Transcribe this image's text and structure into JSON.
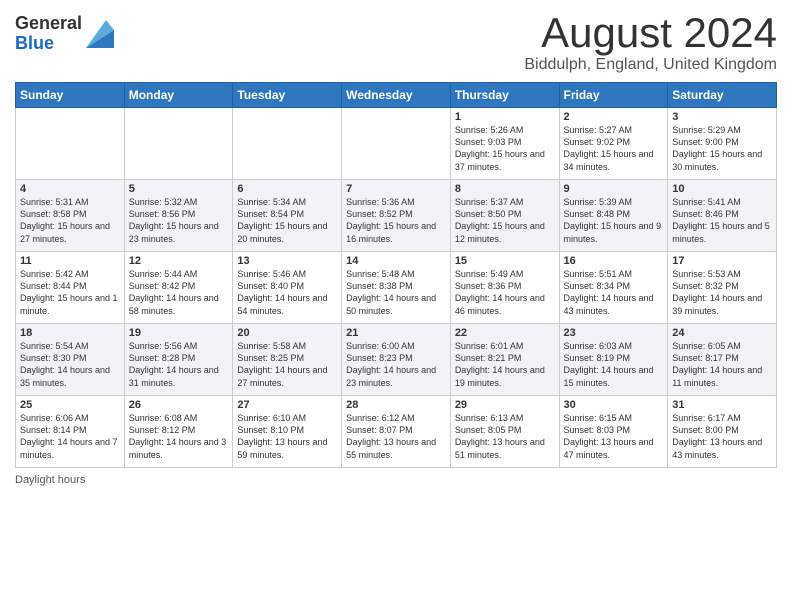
{
  "logo": {
    "general": "General",
    "blue": "Blue"
  },
  "title": "August 2024",
  "location": "Biddulph, England, United Kingdom",
  "footer": "Daylight hours",
  "days_of_week": [
    "Sunday",
    "Monday",
    "Tuesday",
    "Wednesday",
    "Thursday",
    "Friday",
    "Saturday"
  ],
  "weeks": [
    [
      {
        "day": "",
        "sunrise": "",
        "sunset": "",
        "daylight": ""
      },
      {
        "day": "",
        "sunrise": "",
        "sunset": "",
        "daylight": ""
      },
      {
        "day": "",
        "sunrise": "",
        "sunset": "",
        "daylight": ""
      },
      {
        "day": "",
        "sunrise": "",
        "sunset": "",
        "daylight": ""
      },
      {
        "day": "1",
        "sunrise": "Sunrise: 5:26 AM",
        "sunset": "Sunset: 9:03 PM",
        "daylight": "Daylight: 15 hours and 37 minutes."
      },
      {
        "day": "2",
        "sunrise": "Sunrise: 5:27 AM",
        "sunset": "Sunset: 9:02 PM",
        "daylight": "Daylight: 15 hours and 34 minutes."
      },
      {
        "day": "3",
        "sunrise": "Sunrise: 5:29 AM",
        "sunset": "Sunset: 9:00 PM",
        "daylight": "Daylight: 15 hours and 30 minutes."
      }
    ],
    [
      {
        "day": "4",
        "sunrise": "Sunrise: 5:31 AM",
        "sunset": "Sunset: 8:58 PM",
        "daylight": "Daylight: 15 hours and 27 minutes."
      },
      {
        "day": "5",
        "sunrise": "Sunrise: 5:32 AM",
        "sunset": "Sunset: 8:56 PM",
        "daylight": "Daylight: 15 hours and 23 minutes."
      },
      {
        "day": "6",
        "sunrise": "Sunrise: 5:34 AM",
        "sunset": "Sunset: 8:54 PM",
        "daylight": "Daylight: 15 hours and 20 minutes."
      },
      {
        "day": "7",
        "sunrise": "Sunrise: 5:36 AM",
        "sunset": "Sunset: 8:52 PM",
        "daylight": "Daylight: 15 hours and 16 minutes."
      },
      {
        "day": "8",
        "sunrise": "Sunrise: 5:37 AM",
        "sunset": "Sunset: 8:50 PM",
        "daylight": "Daylight: 15 hours and 12 minutes."
      },
      {
        "day": "9",
        "sunrise": "Sunrise: 5:39 AM",
        "sunset": "Sunset: 8:48 PM",
        "daylight": "Daylight: 15 hours and 9 minutes."
      },
      {
        "day": "10",
        "sunrise": "Sunrise: 5:41 AM",
        "sunset": "Sunset: 8:46 PM",
        "daylight": "Daylight: 15 hours and 5 minutes."
      }
    ],
    [
      {
        "day": "11",
        "sunrise": "Sunrise: 5:42 AM",
        "sunset": "Sunset: 8:44 PM",
        "daylight": "Daylight: 15 hours and 1 minute."
      },
      {
        "day": "12",
        "sunrise": "Sunrise: 5:44 AM",
        "sunset": "Sunset: 8:42 PM",
        "daylight": "Daylight: 14 hours and 58 minutes."
      },
      {
        "day": "13",
        "sunrise": "Sunrise: 5:46 AM",
        "sunset": "Sunset: 8:40 PM",
        "daylight": "Daylight: 14 hours and 54 minutes."
      },
      {
        "day": "14",
        "sunrise": "Sunrise: 5:48 AM",
        "sunset": "Sunset: 8:38 PM",
        "daylight": "Daylight: 14 hours and 50 minutes."
      },
      {
        "day": "15",
        "sunrise": "Sunrise: 5:49 AM",
        "sunset": "Sunset: 8:36 PM",
        "daylight": "Daylight: 14 hours and 46 minutes."
      },
      {
        "day": "16",
        "sunrise": "Sunrise: 5:51 AM",
        "sunset": "Sunset: 8:34 PM",
        "daylight": "Daylight: 14 hours and 43 minutes."
      },
      {
        "day": "17",
        "sunrise": "Sunrise: 5:53 AM",
        "sunset": "Sunset: 8:32 PM",
        "daylight": "Daylight: 14 hours and 39 minutes."
      }
    ],
    [
      {
        "day": "18",
        "sunrise": "Sunrise: 5:54 AM",
        "sunset": "Sunset: 8:30 PM",
        "daylight": "Daylight: 14 hours and 35 minutes."
      },
      {
        "day": "19",
        "sunrise": "Sunrise: 5:56 AM",
        "sunset": "Sunset: 8:28 PM",
        "daylight": "Daylight: 14 hours and 31 minutes."
      },
      {
        "day": "20",
        "sunrise": "Sunrise: 5:58 AM",
        "sunset": "Sunset: 8:25 PM",
        "daylight": "Daylight: 14 hours and 27 minutes."
      },
      {
        "day": "21",
        "sunrise": "Sunrise: 6:00 AM",
        "sunset": "Sunset: 8:23 PM",
        "daylight": "Daylight: 14 hours and 23 minutes."
      },
      {
        "day": "22",
        "sunrise": "Sunrise: 6:01 AM",
        "sunset": "Sunset: 8:21 PM",
        "daylight": "Daylight: 14 hours and 19 minutes."
      },
      {
        "day": "23",
        "sunrise": "Sunrise: 6:03 AM",
        "sunset": "Sunset: 8:19 PM",
        "daylight": "Daylight: 14 hours and 15 minutes."
      },
      {
        "day": "24",
        "sunrise": "Sunrise: 6:05 AM",
        "sunset": "Sunset: 8:17 PM",
        "daylight": "Daylight: 14 hours and 11 minutes."
      }
    ],
    [
      {
        "day": "25",
        "sunrise": "Sunrise: 6:06 AM",
        "sunset": "Sunset: 8:14 PM",
        "daylight": "Daylight: 14 hours and 7 minutes."
      },
      {
        "day": "26",
        "sunrise": "Sunrise: 6:08 AM",
        "sunset": "Sunset: 8:12 PM",
        "daylight": "Daylight: 14 hours and 3 minutes."
      },
      {
        "day": "27",
        "sunrise": "Sunrise: 6:10 AM",
        "sunset": "Sunset: 8:10 PM",
        "daylight": "Daylight: 13 hours and 59 minutes."
      },
      {
        "day": "28",
        "sunrise": "Sunrise: 6:12 AM",
        "sunset": "Sunset: 8:07 PM",
        "daylight": "Daylight: 13 hours and 55 minutes."
      },
      {
        "day": "29",
        "sunrise": "Sunrise: 6:13 AM",
        "sunset": "Sunset: 8:05 PM",
        "daylight": "Daylight: 13 hours and 51 minutes."
      },
      {
        "day": "30",
        "sunrise": "Sunrise: 6:15 AM",
        "sunset": "Sunset: 8:03 PM",
        "daylight": "Daylight: 13 hours and 47 minutes."
      },
      {
        "day": "31",
        "sunrise": "Sunrise: 6:17 AM",
        "sunset": "Sunset: 8:00 PM",
        "daylight": "Daylight: 13 hours and 43 minutes."
      }
    ]
  ]
}
